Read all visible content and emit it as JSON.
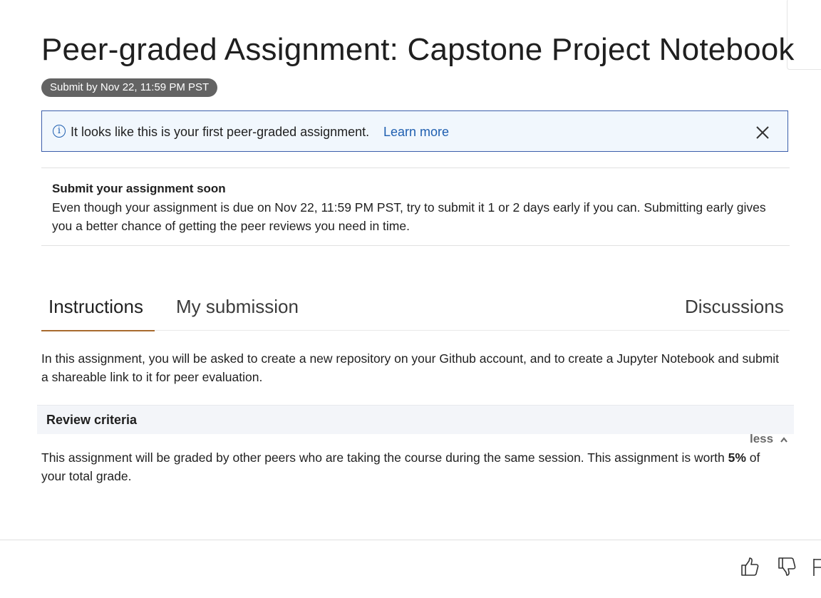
{
  "header": {
    "title": "Peer-graded Assignment: Capstone Project Notebook",
    "due_badge": "Submit by Nov 22, 11:59 PM PST"
  },
  "info_banner": {
    "icon": "info-icon",
    "message": "It looks like this is your first peer-graded assignment.",
    "link_label": "Learn more",
    "close_icon": "close-icon",
    "accent_color": "#3c5eaa"
  },
  "notice": {
    "heading": "Submit your assignment soon",
    "body": "Even though your assignment is due on Nov 22, 11:59 PM PST, try to submit it 1 or 2 days early if you can. Submitting early gives you a better chance of getting the peer reviews you need in time."
  },
  "tabs": [
    {
      "label": "Instructions",
      "active": true
    },
    {
      "label": "My submission",
      "active": false
    },
    {
      "label": "Discussions",
      "active": false
    }
  ],
  "instructions": {
    "intro": "In this assignment, you will be asked to create a new repository on your Github account, and to create a Jupyter Notebook and submit a shareable link to it for peer evaluation."
  },
  "review_criteria": {
    "heading": "Review criteria",
    "toggle_label": "less",
    "body_before": "This assignment will be graded by other peers who are taking the course during the same session. This assignment is worth ",
    "body_bold": "5%",
    "body_after": " of your total grade."
  },
  "footer": {
    "icons": [
      "thumbs-up-icon",
      "thumbs-down-icon",
      "flag-icon"
    ]
  },
  "colors": {
    "tab_active_underline": "#a86a2e",
    "link": "#1f5fb0",
    "badge_bg": "#636363"
  }
}
